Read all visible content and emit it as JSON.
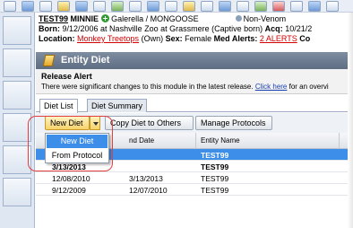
{
  "header": {
    "animal_id": "TEST99",
    "animal_name": "MINNIE",
    "taxonomy": "Galerella / MONGOOSE",
    "venom": "Non-Venom",
    "born_label": "Born:",
    "born_value": "9/12/2006 at Nashville Zoo at Grassmere",
    "born_type": "(Captive born)",
    "acq_label": "Acq:",
    "acq_value": "10/21/2",
    "location_label": "Location:",
    "location_value": "Monkey Treetops",
    "ownership": "(Own)",
    "sex_label": "Sex:",
    "sex_value": "Female",
    "alerts_label": "Med Alerts:",
    "alerts_value": "2 ALERTS",
    "co_label": "Co"
  },
  "module": {
    "title": "Entity Diet"
  },
  "release_alert": {
    "title": "Release Alert",
    "message_before": "There were significant changes to this module in the latest release.",
    "link": "Click here",
    "message_after": "for an overvi"
  },
  "tabs": [
    {
      "label": "Diet List",
      "active": true
    },
    {
      "label": "Diet Summary",
      "active": false
    }
  ],
  "toolbar": {
    "new_diet": "New Diet",
    "copy_diet": "Copy Diet to Others",
    "manage_protocols": "Manage Protocols"
  },
  "dropdown": {
    "items": [
      "New Diet",
      "From Protocol"
    ]
  },
  "grid": {
    "columns": [
      "",
      "nd Date",
      "Entity Name"
    ],
    "rows": [
      {
        "start": "",
        "end": "",
        "entity": "TEST99",
        "selected": true,
        "bold": true
      },
      {
        "start": "3/13/2013",
        "end": "",
        "entity": "TEST99",
        "selected": false,
        "bold": true
      },
      {
        "start": "12/08/2010",
        "end": "3/13/2013",
        "entity": "TEST99",
        "selected": false,
        "bold": false
      },
      {
        "start": "9/12/2009",
        "end": "12/07/2010",
        "entity": "TEST99",
        "selected": false,
        "bold": false
      }
    ]
  },
  "colors": {
    "accent_red": "#d20000",
    "selection_blue": "#3d8ee8",
    "titlebar": "#6f7c91",
    "button_gold": "#f6d36b"
  }
}
